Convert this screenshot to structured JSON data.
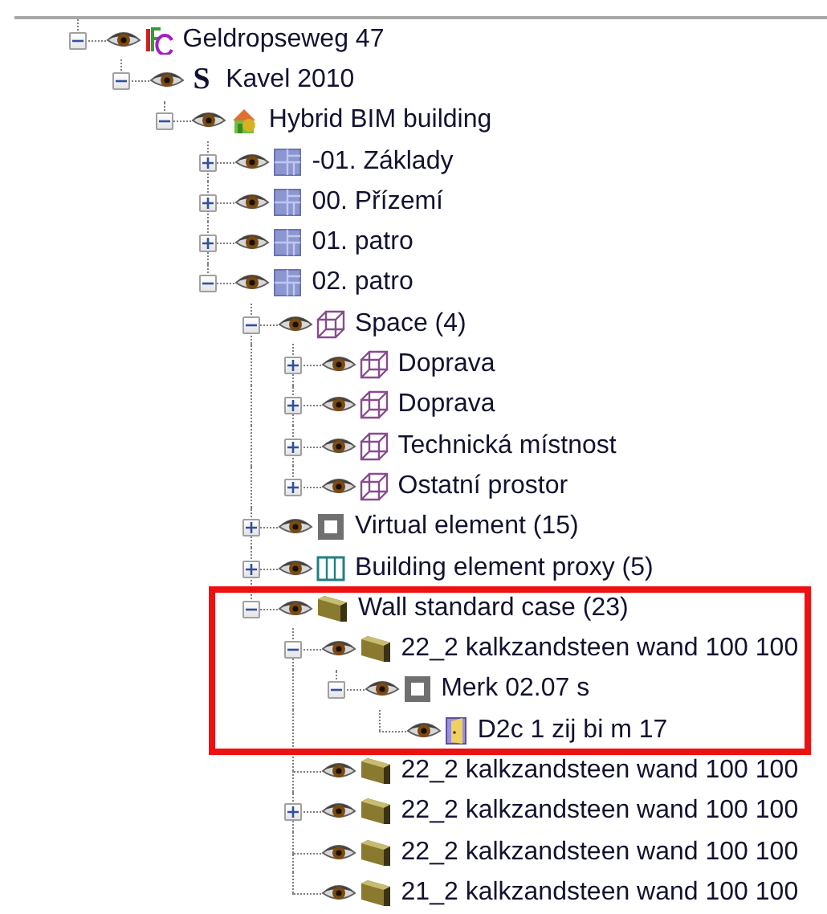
{
  "tree": [
    {
      "label": "Geldropseweg 47",
      "kind": "project",
      "expanded": true,
      "leaf": false,
      "boxed": false,
      "children": [
        {
          "label": "Kavel 2010",
          "kind": "site",
          "glyph": "S",
          "expanded": true,
          "leaf": false,
          "boxed": false,
          "children": [
            {
              "label": "Hybrid BIM building",
              "kind": "building",
              "expanded": true,
              "leaf": false,
              "boxed": false,
              "children": [
                {
                  "label": "-01. Základy",
                  "kind": "storey",
                  "expanded": false,
                  "leaf": false,
                  "boxed": false
                },
                {
                  "label": "00. Přízemí",
                  "kind": "storey",
                  "expanded": false,
                  "leaf": false,
                  "boxed": false
                },
                {
                  "label": "01. patro",
                  "kind": "storey",
                  "expanded": false,
                  "leaf": false,
                  "boxed": false
                },
                {
                  "label": "02. patro",
                  "kind": "storey",
                  "expanded": true,
                  "leaf": false,
                  "boxed": false,
                  "children": [
                    {
                      "label": "Space (4)",
                      "kind": "space",
                      "expanded": true,
                      "leaf": false,
                      "boxed": false,
                      "children": [
                        {
                          "label": "Doprava",
                          "kind": "space",
                          "expanded": false,
                          "leaf": false,
                          "boxed": false
                        },
                        {
                          "label": "Doprava",
                          "kind": "space",
                          "expanded": false,
                          "leaf": false,
                          "boxed": false
                        },
                        {
                          "label": "Technická místnost",
                          "kind": "space",
                          "expanded": false,
                          "leaf": false,
                          "boxed": false
                        },
                        {
                          "label": "Ostatní prostor",
                          "kind": "space",
                          "expanded": false,
                          "leaf": false,
                          "boxed": false
                        }
                      ]
                    },
                    {
                      "label": "Virtual element (15)",
                      "kind": "virtual",
                      "expanded": false,
                      "leaf": false,
                      "boxed": false
                    },
                    {
                      "label": "Building element proxy (5)",
                      "kind": "proxy",
                      "expanded": false,
                      "leaf": false,
                      "boxed": false
                    },
                    {
                      "label": "Wall standard case (23)",
                      "kind": "wall",
                      "expanded": true,
                      "leaf": false,
                      "boxed": true,
                      "children": [
                        {
                          "label": "22_2 kalkzandsteen wand 100 100",
                          "kind": "wall",
                          "expanded": true,
                          "leaf": false,
                          "boxed": true,
                          "children": [
                            {
                              "label": "Merk 02.07 s",
                              "kind": "opening",
                              "expanded": true,
                              "leaf": false,
                              "boxed": true,
                              "children": [
                                {
                                  "label": "D2c 1 zij bi m 17",
                                  "kind": "door",
                                  "leaf": true,
                                  "boxed": true
                                }
                              ]
                            }
                          ]
                        },
                        {
                          "label": "22_2 kalkzandsteen wand 100 100",
                          "kind": "wall",
                          "leaf": true,
                          "boxed": false
                        },
                        {
                          "label": "22_2 kalkzandsteen wand 100 100",
                          "kind": "wall",
                          "expanded": false,
                          "leaf": false,
                          "boxed": false
                        },
                        {
                          "label": "22_2 kalkzandsteen wand 100 100",
                          "kind": "wall",
                          "leaf": true,
                          "boxed": false
                        },
                        {
                          "label": "21_2 kalkzandsteen wand 100 100",
                          "kind": "wall",
                          "leaf": true,
                          "boxed": false
                        }
                      ]
                    }
                  ]
                }
              ]
            }
          ]
        }
      ]
    }
  ]
}
